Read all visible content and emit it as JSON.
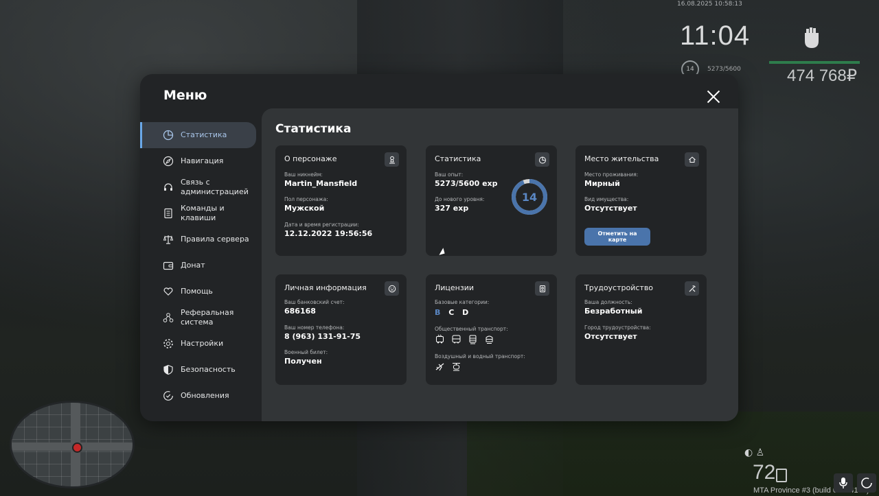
{
  "hud": {
    "datetime": "16.08.2025 10:58:13",
    "time": "11:04",
    "level": "14",
    "exp": "5273/5600",
    "money": "474 768₽",
    "speed": "72",
    "server": "MTA Province #3 (build 0.4.24105)"
  },
  "menu": {
    "title": "Меню",
    "sidebar": [
      {
        "label": "Статистика",
        "icon": "pie-chart-icon",
        "active": true
      },
      {
        "label": "Навигация",
        "icon": "compass-icon"
      },
      {
        "label": "Связь с администрацией",
        "icon": "headset-icon"
      },
      {
        "label": "Команды и клавиши",
        "icon": "document-icon"
      },
      {
        "label": "Правила сервера",
        "icon": "scales-icon"
      },
      {
        "label": "Донат",
        "icon": "wallet-icon"
      },
      {
        "label": "Помощь",
        "icon": "heart-hands-icon"
      },
      {
        "label": "Реферальная система",
        "icon": "network-icon"
      },
      {
        "label": "Настройки",
        "icon": "gear-icon"
      },
      {
        "label": "Безопасность",
        "icon": "shield-icon"
      },
      {
        "label": "Обновления",
        "icon": "refresh-check-icon"
      }
    ],
    "content_title": "Статистика",
    "cards": {
      "character": {
        "title": "О персонаже",
        "nickname_label": "Ваш никнейм:",
        "nickname": "Martin_Mansfield",
        "gender_label": "Пол персонажа:",
        "gender": "Мужской",
        "reg_label": "Дата и время регистрации:",
        "reg": "12.12.2022 19:56:56"
      },
      "stats": {
        "title": "Статистика",
        "exp_label": "Ваш опыт:",
        "exp": "5273/5600 exp",
        "next_label": "До нового уровня:",
        "next": "327 exp",
        "level": "14",
        "progress": 0.94
      },
      "residence": {
        "title": "Место жительства",
        "place_label": "Место проживания:",
        "place": "Мирный",
        "property_label": "Вид имущества:",
        "property": "Отсутствует",
        "button": "Отметить на карте"
      },
      "personal": {
        "title": "Личная информация",
        "bank_label": "Ваш банковский счет:",
        "bank": "686168",
        "phone_label": "Ваш номер телефона:",
        "phone": "8 (963) 131-91-75",
        "military_label": "Военный билет:",
        "military": "Получен"
      },
      "licenses": {
        "title": "Лицензии",
        "basic_label": "Базовые категории:",
        "categories": [
          {
            "name": "B",
            "color": "#5a87c4"
          },
          {
            "name": "C",
            "color": "#ffffff"
          },
          {
            "name": "D",
            "color": "#ffffff"
          }
        ],
        "public_label": "Общественный транспорт:",
        "air_label": "Воздушный и водный транспорт:"
      },
      "employment": {
        "title": "Трудоустройство",
        "position_label": "Ваша должность:",
        "position": "Безработный",
        "city_label": "Город трудоустройства:",
        "city": "Отсутствует"
      }
    }
  }
}
